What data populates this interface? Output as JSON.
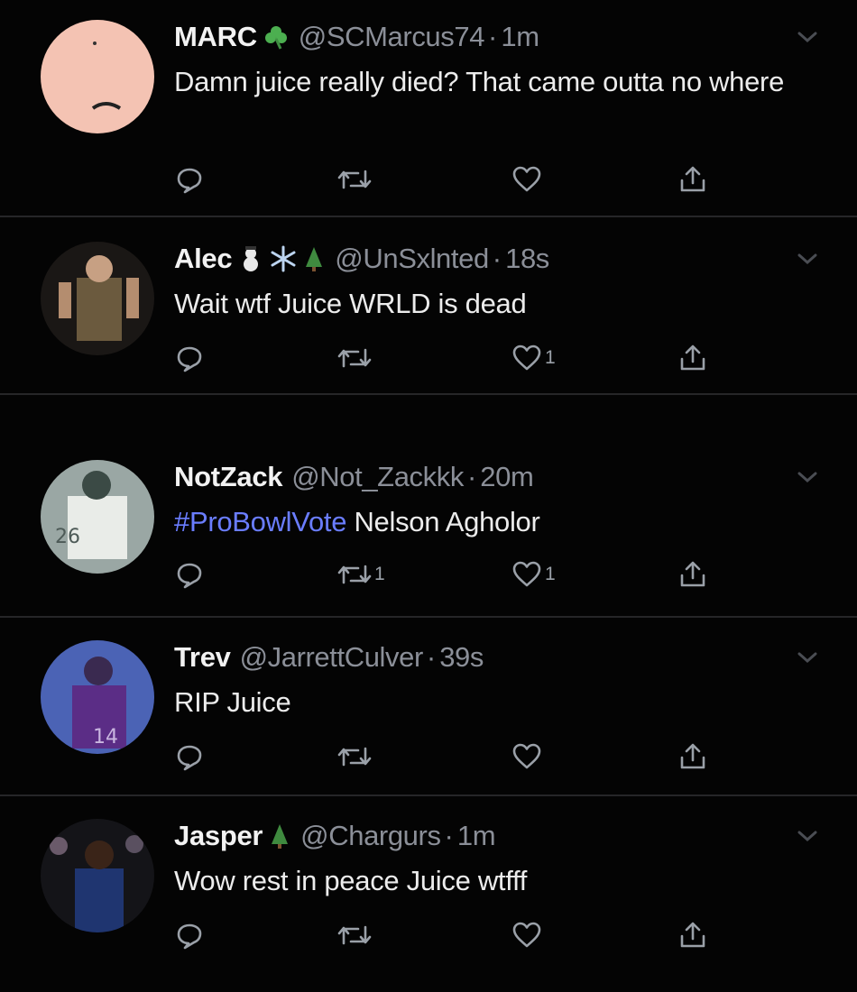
{
  "tweets": [
    {
      "name": "MARC",
      "emojis": [
        "shamrock-icon"
      ],
      "handle": "@SCMarcus74",
      "time": "1m",
      "text": "Damn juice really died? That came outta no where",
      "retweets": "",
      "likes": ""
    },
    {
      "name": "Alec",
      "emojis": [
        "snowman-icon",
        "snowflake-icon",
        "christmas-tree-icon"
      ],
      "handle": "@UnSxlnted",
      "time": "18s",
      "text": "Wait wtf Juice WRLD is dead",
      "retweets": "",
      "likes": "1"
    },
    {
      "name": "NotZack",
      "emojis": [],
      "handle": "@Not_Zackkk",
      "time": "20m",
      "hashtag": "#ProBowlVote",
      "text": "Nelson Agholor",
      "retweets": "1",
      "likes": "1"
    },
    {
      "name": "Trev",
      "emojis": [],
      "handle": "@JarrettCulver",
      "time": "39s",
      "text": "RIP Juice",
      "retweets": "",
      "likes": ""
    },
    {
      "name": "Jasper",
      "emojis": [
        "christmas-tree-icon"
      ],
      "handle": "@Chargurs",
      "time": "1m",
      "text": "Wow rest in peace Juice wtfff",
      "retweets": "",
      "likes": ""
    }
  ],
  "separator": "·",
  "colors": {
    "background": "#040404",
    "handle_gray": "#8b8f98",
    "hashtag_blue": "#6a7dff",
    "divider": "#262628"
  }
}
